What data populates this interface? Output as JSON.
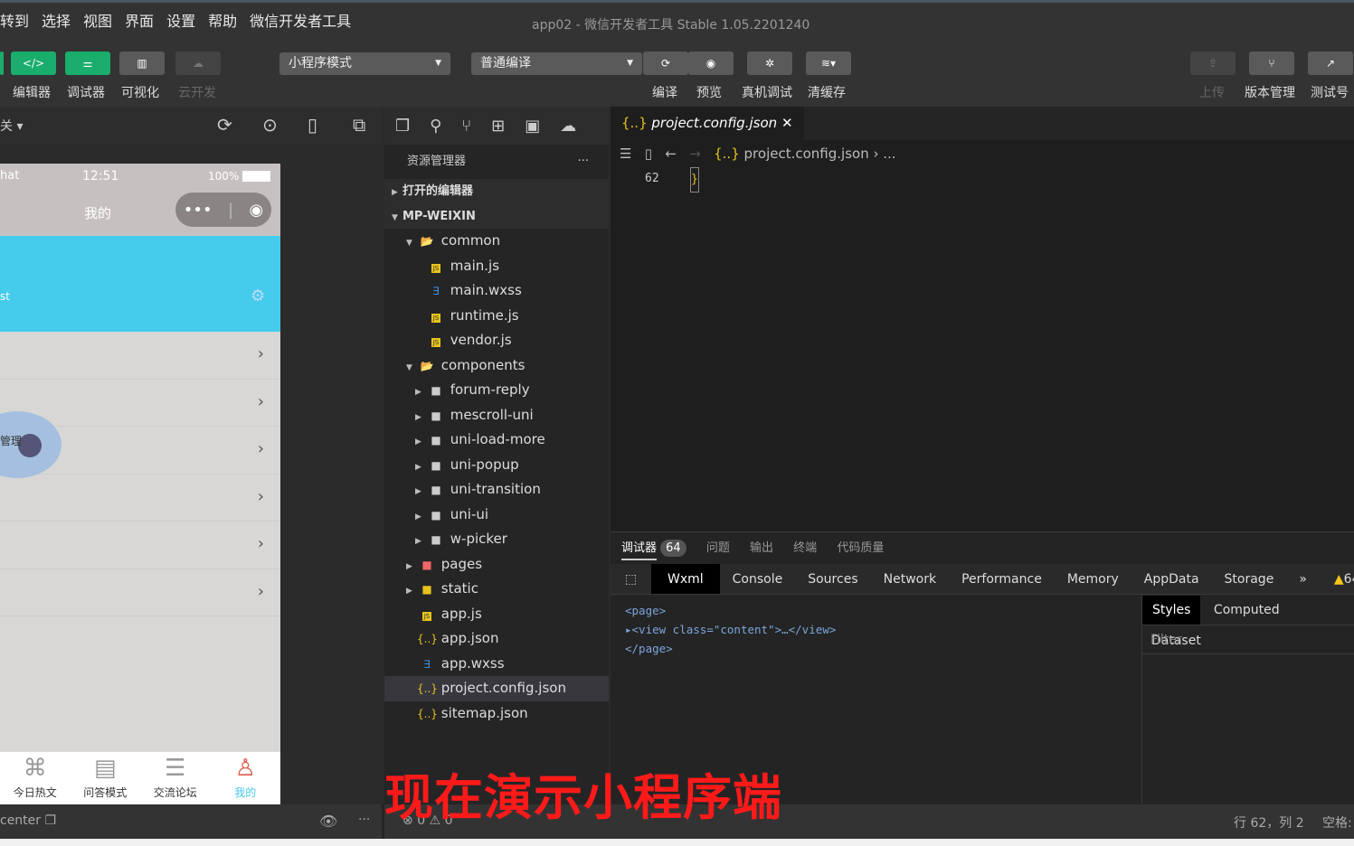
{
  "menu": [
    "转到",
    "选择",
    "视图",
    "界面",
    "设置",
    "帮助",
    "微信开发者工具"
  ],
  "window_title": "app02 - 微信开发者工具 Stable 1.05.2201240",
  "toolbar": {
    "editor": "编辑器",
    "debugger": "调试器",
    "visual": "可视化",
    "cloud": "云开发",
    "mode": "小程序模式",
    "compile_mode": "普通编译",
    "compile": "编译",
    "preview": "预览",
    "device_debug": "真机调试",
    "clear_cache": "清缓存",
    "upload": "上传",
    "version": "版本管理",
    "test": "测试号",
    "accent": "#1aad6b"
  },
  "simulator": {
    "network": "关",
    "status_left": "hat",
    "time": "12:51",
    "battery": "100%",
    "nav_title": "我的",
    "banner_text": "st",
    "avatar_text": "管理",
    "banner_color": "#45cbeb",
    "tabs": [
      "今日热文",
      "问答模式",
      "交流论坛",
      "我的"
    ],
    "active_tab": "我的",
    "path": "center"
  },
  "explorer": {
    "title": "资源管理器",
    "more": "···",
    "open_editors": "打开的编辑器",
    "root": "MP-WEIXIN",
    "files": [
      {
        "name": "common",
        "type": "folder-open",
        "depth": 1,
        "arrow": "▼"
      },
      {
        "name": "main.js",
        "type": "js",
        "depth": 2
      },
      {
        "name": "main.wxss",
        "type": "css",
        "depth": 2
      },
      {
        "name": "runtime.js",
        "type": "js",
        "depth": 2
      },
      {
        "name": "vendor.js",
        "type": "js",
        "depth": 2
      },
      {
        "name": "components",
        "type": "folder-open",
        "depth": 1,
        "arrow": "▼"
      },
      {
        "name": "forum-reply",
        "type": "folder",
        "depth": 2,
        "arrow": "▶"
      },
      {
        "name": "mescroll-uni",
        "type": "folder",
        "depth": 2,
        "arrow": "▶"
      },
      {
        "name": "uni-load-more",
        "type": "folder",
        "depth": 2,
        "arrow": "▶"
      },
      {
        "name": "uni-popup",
        "type": "folder",
        "depth": 2,
        "arrow": "▶"
      },
      {
        "name": "uni-transition",
        "type": "folder",
        "depth": 2,
        "arrow": "▶"
      },
      {
        "name": "uni-ui",
        "type": "folder",
        "depth": 2,
        "arrow": "▶"
      },
      {
        "name": "w-picker",
        "type": "folder",
        "depth": 2,
        "arrow": "▶"
      },
      {
        "name": "pages",
        "type": "folder-red",
        "depth": 1,
        "arrow": "▶"
      },
      {
        "name": "static",
        "type": "folder-yellow",
        "depth": 1,
        "arrow": "▶"
      },
      {
        "name": "app.js",
        "type": "js",
        "depth": 1
      },
      {
        "name": "app.json",
        "type": "json",
        "depth": 1
      },
      {
        "name": "app.wxss",
        "type": "css",
        "depth": 1
      },
      {
        "name": "project.config.json",
        "type": "json",
        "depth": 1,
        "selected": true
      },
      {
        "name": "sitemap.json",
        "type": "json",
        "depth": 1
      }
    ]
  },
  "editor": {
    "tab": "project.config.json",
    "breadcrumb": "project.config.json",
    "breadcrumb_more": "...",
    "line_no": "62",
    "line_text": "}"
  },
  "debugger": {
    "tabs": [
      "调试器",
      "问题",
      "输出",
      "终端",
      "代码质量"
    ],
    "badge": "64",
    "devtabs": [
      "Wxml",
      "Console",
      "Sources",
      "Network",
      "Performance",
      "Memory",
      "AppData",
      "Storage"
    ],
    "more": "»",
    "warn": "64",
    "wxml": [
      "<page>",
      "<view class=\"content\">…</view>",
      "</page>"
    ],
    "side_tabs": [
      "Styles",
      "Computed",
      "Dataset"
    ],
    "filter": "Filter"
  },
  "statusbar": {
    "errors": "0",
    "warnings": "0",
    "position": "行 62，列 2",
    "spaces": "空格:"
  },
  "subtitle": "现在演示小程序端"
}
